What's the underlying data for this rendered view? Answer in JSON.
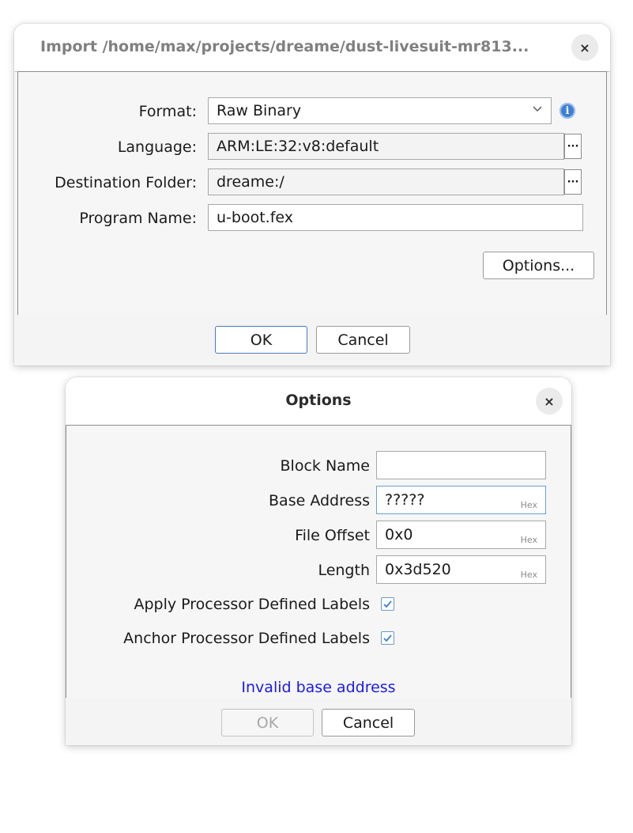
{
  "import_dialog": {
    "title": "Import /home/max/projects/dreame/dust-livesuit-mr813...",
    "close_glyph": "×",
    "format": {
      "label": "Format:",
      "value": "Raw Binary"
    },
    "language": {
      "label": "Language:",
      "value": "ARM:LE:32:v8:default"
    },
    "destination": {
      "label": "Destination Folder:",
      "value": "dreame:/"
    },
    "program_name": {
      "label": "Program Name:",
      "value": "u-boot.fex"
    },
    "browse_glyph": "···",
    "info_glyph": "i",
    "options_button": "Options...",
    "ok_button": "OK",
    "cancel_button": "Cancel"
  },
  "options_dialog": {
    "title": "Options",
    "close_glyph": "×",
    "block_name": {
      "label": "Block Name",
      "value": ""
    },
    "base_address": {
      "label": "Base Address",
      "value": "?????",
      "suffix": "Hex"
    },
    "file_offset": {
      "label": "File Offset",
      "value": "0x0",
      "suffix": "Hex"
    },
    "length": {
      "label": "Length",
      "value": "0x3d520",
      "suffix": "Hex"
    },
    "apply_labels": {
      "label": "Apply Processor Defined Labels",
      "checked": true
    },
    "anchor_labels": {
      "label": "Anchor Processor Defined Labels",
      "checked": true
    },
    "status": "Invalid base address",
    "ok_button": "OK",
    "cancel_button": "Cancel"
  },
  "colors": {
    "status_text": "#1a1af0",
    "checkbox_check": "#3b7dd8",
    "info_icon": "#3f7fd1"
  }
}
